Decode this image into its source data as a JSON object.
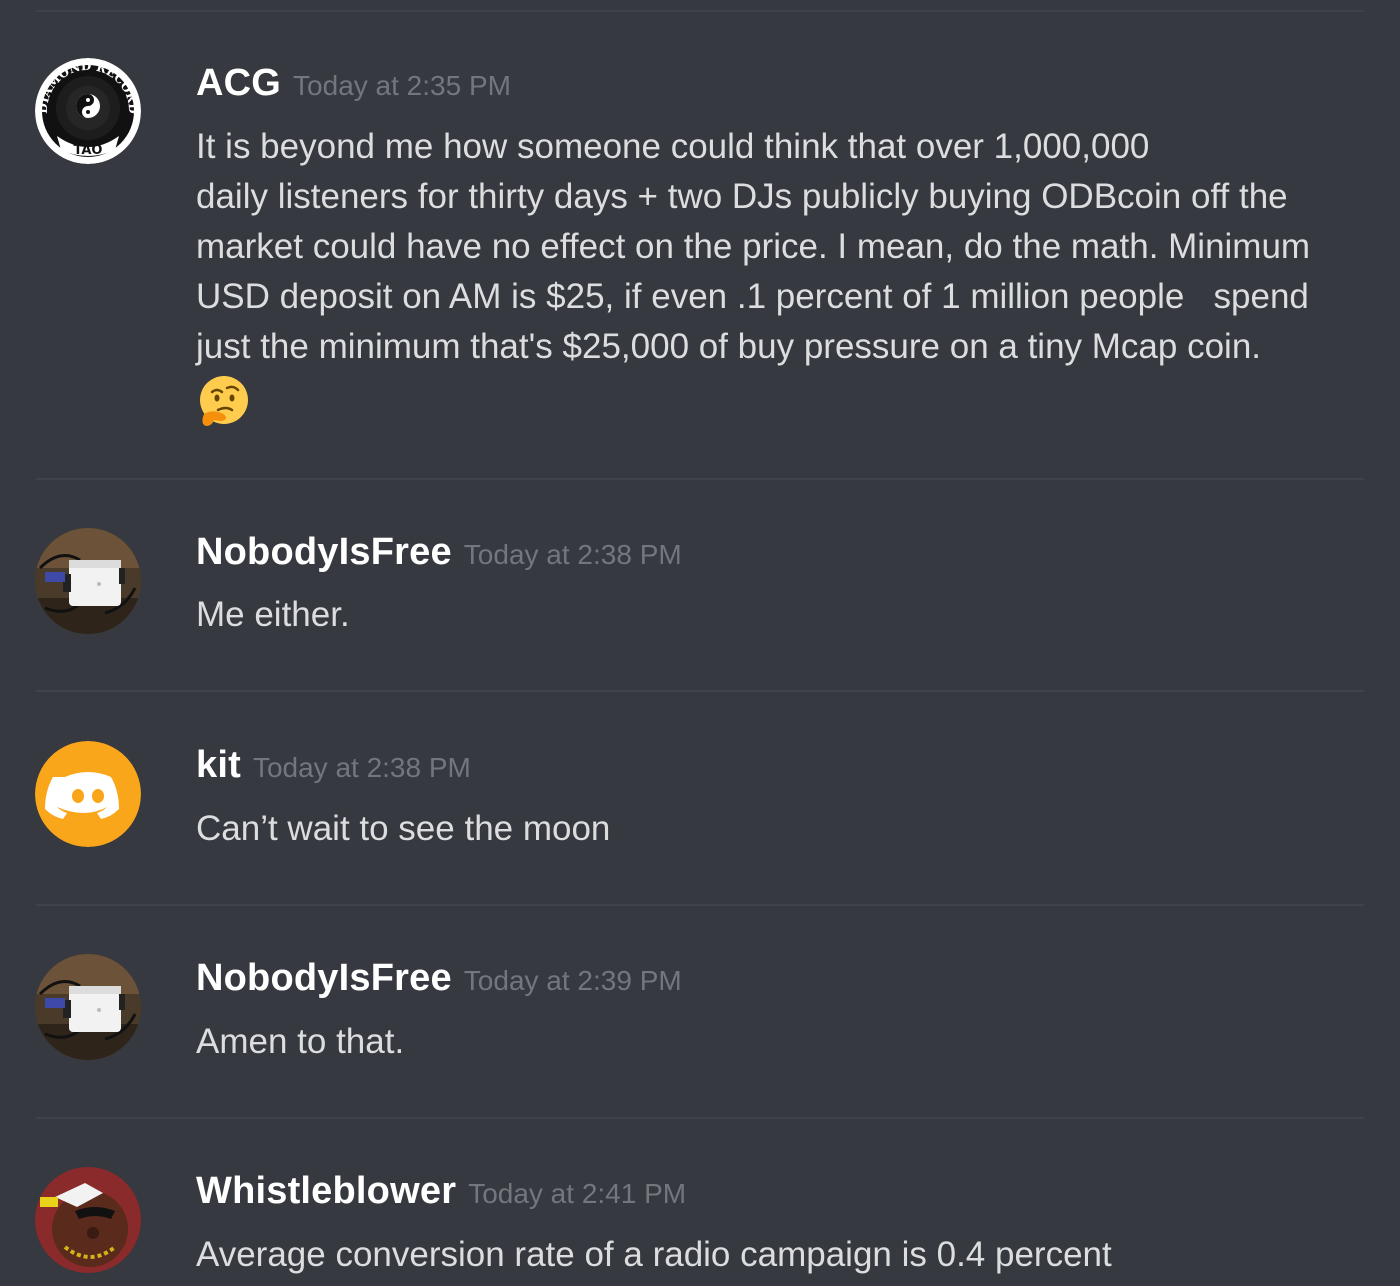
{
  "messages": [
    {
      "username": "ACG",
      "timestamp": "Today at 2:35 PM",
      "avatar": "diamond-record-logo",
      "avatar_text": {
        "top": "DIAMOND RECORD",
        "bottom": "TAO"
      },
      "lines": [
        "It is beyond me how someone could think that over 1,000,000",
        "daily listeners for thirty days + two DJs publicly buying ODBcoin off the",
        "market could have no effect on the price. I mean, do the math. Minimum",
        "USD deposit on AM is $25, if even .1 percent of 1 million people   spend",
        "just the minimum that's $25,000 of buy pressure on a tiny Mcap coin."
      ],
      "emoji": "thinking-face"
    },
    {
      "username": "NobodyIsFree",
      "timestamp": "Today at 2:38 PM",
      "avatar": "hardware-device-photo",
      "lines": [
        "Me either."
      ]
    },
    {
      "username": "kit",
      "timestamp": "Today at 2:38 PM",
      "avatar": "discord-default-orange",
      "lines": [
        "Can’t wait to see the moon"
      ]
    },
    {
      "username": "NobodyIsFree",
      "timestamp": "Today at 2:39 PM",
      "avatar": "hardware-device-photo",
      "lines": [
        "Amen to that."
      ]
    },
    {
      "username": "Whistleblower",
      "timestamp": "Today at 2:41 PM",
      "avatar": "cartoon-rapper",
      "lines": [
        "Average conversion rate of a radio campaign is 0.4 percent"
      ]
    }
  ],
  "colors": {
    "background": "#36393f",
    "username": "#ffffff",
    "timestamp": "#72767d",
    "text": "#dcddde",
    "divider": "#40434a",
    "discord_orange": "#faa61a"
  }
}
